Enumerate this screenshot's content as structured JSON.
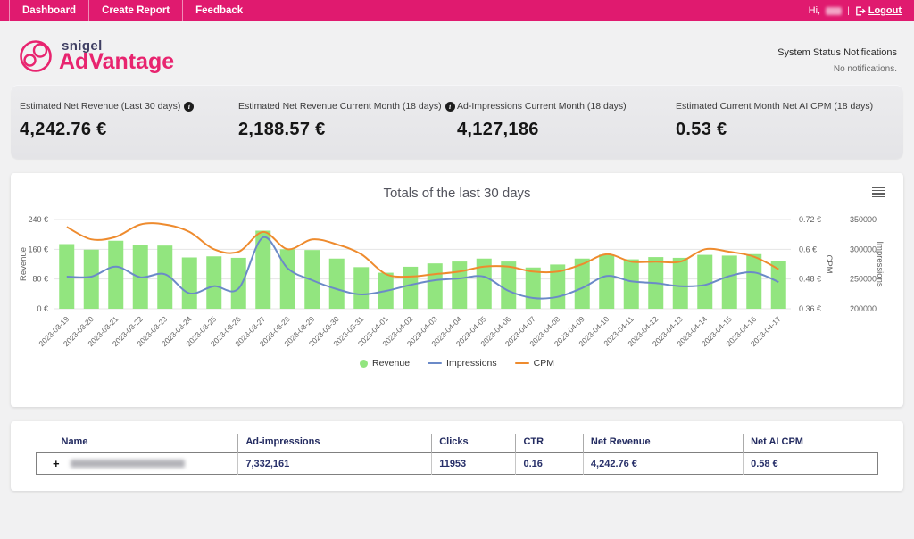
{
  "nav": {
    "items": [
      {
        "label": "Dashboard"
      },
      {
        "label": "Create Report"
      },
      {
        "label": "Feedback"
      }
    ],
    "greeting": "Hi,",
    "username_redacted": true,
    "separator": "|",
    "logout_label": "Logout"
  },
  "header": {
    "brand_top": "snigel",
    "brand_bottom": "AdVantage",
    "status_title": "System Status Notifications",
    "status_message": "No notifications."
  },
  "stats": [
    {
      "label": "Estimated Net Revenue (Last 30 days)",
      "has_info_icon": true,
      "value": "4,242.76 €"
    },
    {
      "label": "Estimated Net Revenue Current Month (18 days)",
      "has_info_icon": true,
      "value": "2,188.57 €"
    },
    {
      "label": "Ad-Impressions Current Month (18 days)",
      "has_info_icon": false,
      "value": "4,127,186"
    },
    {
      "label": "Estimated Current Month Net AI CPM (18 days)",
      "has_info_icon": false,
      "value": "0.53 €"
    }
  ],
  "chart_data": {
    "type": "bar+line combo",
    "title": "Totals of the last 30 days",
    "grid": true,
    "legend_position": "bottom-center",
    "categories": [
      "2023-03-19",
      "2023-03-20",
      "2023-03-21",
      "2023-03-22",
      "2023-03-23",
      "2023-03-24",
      "2023-03-25",
      "2023-03-26",
      "2023-03-27",
      "2023-03-28",
      "2023-03-29",
      "2023-03-30",
      "2023-03-31",
      "2023-04-01",
      "2023-04-02",
      "2023-04-03",
      "2023-04-04",
      "2023-04-05",
      "2023-04-06",
      "2023-04-07",
      "2023-04-08",
      "2023-04-09",
      "2023-04-10",
      "2023-04-11",
      "2023-04-12",
      "2023-04-13",
      "2023-04-14",
      "2023-04-15",
      "2023-04-16",
      "2023-04-17"
    ],
    "series": [
      {
        "name": "Revenue",
        "type": "bar",
        "axis": "revenue",
        "color": "#92E57F",
        "values": [
          174,
          159,
          183,
          172,
          170,
          138,
          141,
          137,
          210,
          160,
          158,
          135,
          112,
          97,
          113,
          122,
          127,
          135,
          127,
          111,
          119,
          135,
          146,
          133,
          139,
          137,
          145,
          143,
          147,
          129
        ]
      },
      {
        "name": "Impressions",
        "type": "line",
        "axis": "impressions",
        "color": "#6B8AC8",
        "values": [
          254000,
          254000,
          271000,
          253000,
          258000,
          226000,
          238000,
          234000,
          320000,
          268000,
          248000,
          233000,
          224000,
          230000,
          240000,
          248000,
          251000,
          254000,
          230000,
          218000,
          220000,
          235000,
          255000,
          246000,
          243000,
          238000,
          240000,
          255000,
          261000,
          245000
        ]
      },
      {
        "name": "CPM",
        "type": "line",
        "axis": "cpm",
        "color": "#EE8B2E",
        "values": [
          0.69,
          0.64,
          0.65,
          0.7,
          0.7,
          0.67,
          0.6,
          0.59,
          0.67,
          0.6,
          0.64,
          0.62,
          0.58,
          0.5,
          0.49,
          0.5,
          0.51,
          0.53,
          0.53,
          0.51,
          0.51,
          0.54,
          0.58,
          0.55,
          0.55,
          0.55,
          0.6,
          0.59,
          0.57,
          0.52
        ]
      }
    ],
    "axes": {
      "revenue": {
        "title": "Revenue",
        "side": "left",
        "min": 0,
        "max": 240,
        "tick_values": [
          0,
          80,
          160,
          240
        ],
        "tick_labels": [
          "0 €",
          "80 €",
          "160 €",
          "240 €"
        ]
      },
      "cpm": {
        "title": "CPM",
        "side": "right",
        "min": 0.36,
        "max": 0.72,
        "tick_values": [
          0.36,
          0.48,
          0.6,
          0.72
        ],
        "tick_labels": [
          "0.36 €",
          "0.48 €",
          "0.6 €",
          "0.72 €"
        ]
      },
      "impressions": {
        "title": "Impressions",
        "side": "right",
        "min": 200000,
        "max": 350000,
        "tick_values": [
          200000,
          250000,
          300000,
          350000
        ],
        "tick_labels": [
          "200000",
          "250000",
          "300000",
          "350000"
        ]
      }
    }
  },
  "table": {
    "headers": [
      "Name",
      "Ad-impressions",
      "Clicks",
      "CTR",
      "Net Revenue",
      "Net AI CPM"
    ],
    "expander_symbol": "+",
    "rows": [
      {
        "name_redacted": true,
        "ad_impressions": "7,332,161",
        "clicks": "11953",
        "ctr": "0.16",
        "net_revenue": "4,242.76 €",
        "net_ai_cpm": "0.58 €"
      }
    ]
  },
  "colors": {
    "nav_background": "#E01A6F",
    "brand_pink": "#E8246F",
    "brand_navy": "#3F3F63",
    "page_background": "#F1F1F2",
    "stats_band_background": "#E8E8EA",
    "bar_green": "#92E57F",
    "line_blue": "#6B8AC8",
    "line_orange": "#EE8B2E"
  }
}
